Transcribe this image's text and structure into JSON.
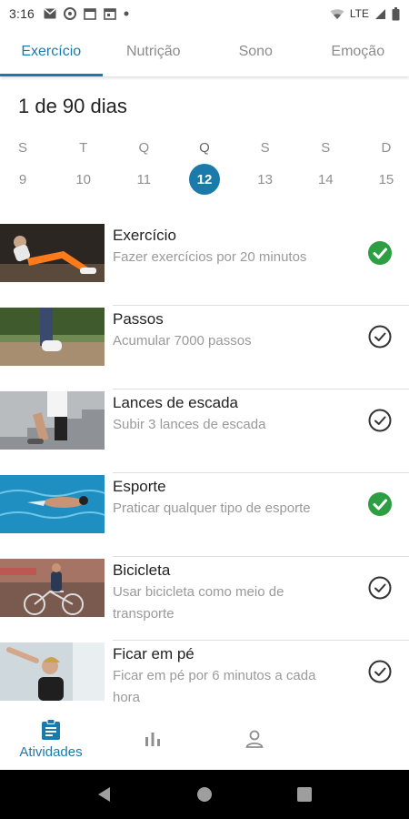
{
  "status_bar": {
    "time": "3:16",
    "network": "LTE"
  },
  "tabs": [
    {
      "label": "Exercício",
      "active": true
    },
    {
      "label": "Nutrição",
      "active": false
    },
    {
      "label": "Sono",
      "active": false
    },
    {
      "label": "Emoção",
      "active": false
    }
  ],
  "progress": {
    "label": "1 de 90 dias"
  },
  "week": {
    "letters": [
      "S",
      "T",
      "Q",
      "Q",
      "S",
      "S",
      "D"
    ],
    "days": [
      "9",
      "10",
      "11",
      "12",
      "13",
      "14",
      "15"
    ],
    "selected_index": 3
  },
  "activities": [
    {
      "title": "Exercício",
      "subtitle": "Fazer exercícios por 20 minutos",
      "completed": true
    },
    {
      "title": "Passos",
      "subtitle": "Acumular 7000 passos",
      "completed": false
    },
    {
      "title": "Lances de escada",
      "subtitle": "Subir 3 lances de escada",
      "completed": false
    },
    {
      "title": "Esporte",
      "subtitle": "Praticar qualquer tipo de esporte",
      "completed": true
    },
    {
      "title": "Bicicleta",
      "subtitle": "Usar bicicleta como meio de transporte",
      "completed": false
    },
    {
      "title": "Ficar em pé",
      "subtitle": "Ficar em pé por 6 minutos a cada hora",
      "completed": false
    }
  ],
  "bottom_nav": {
    "activities_label": "Atividades"
  },
  "colors": {
    "accent": "#1a7bab",
    "done_green": "#2e9e43"
  }
}
